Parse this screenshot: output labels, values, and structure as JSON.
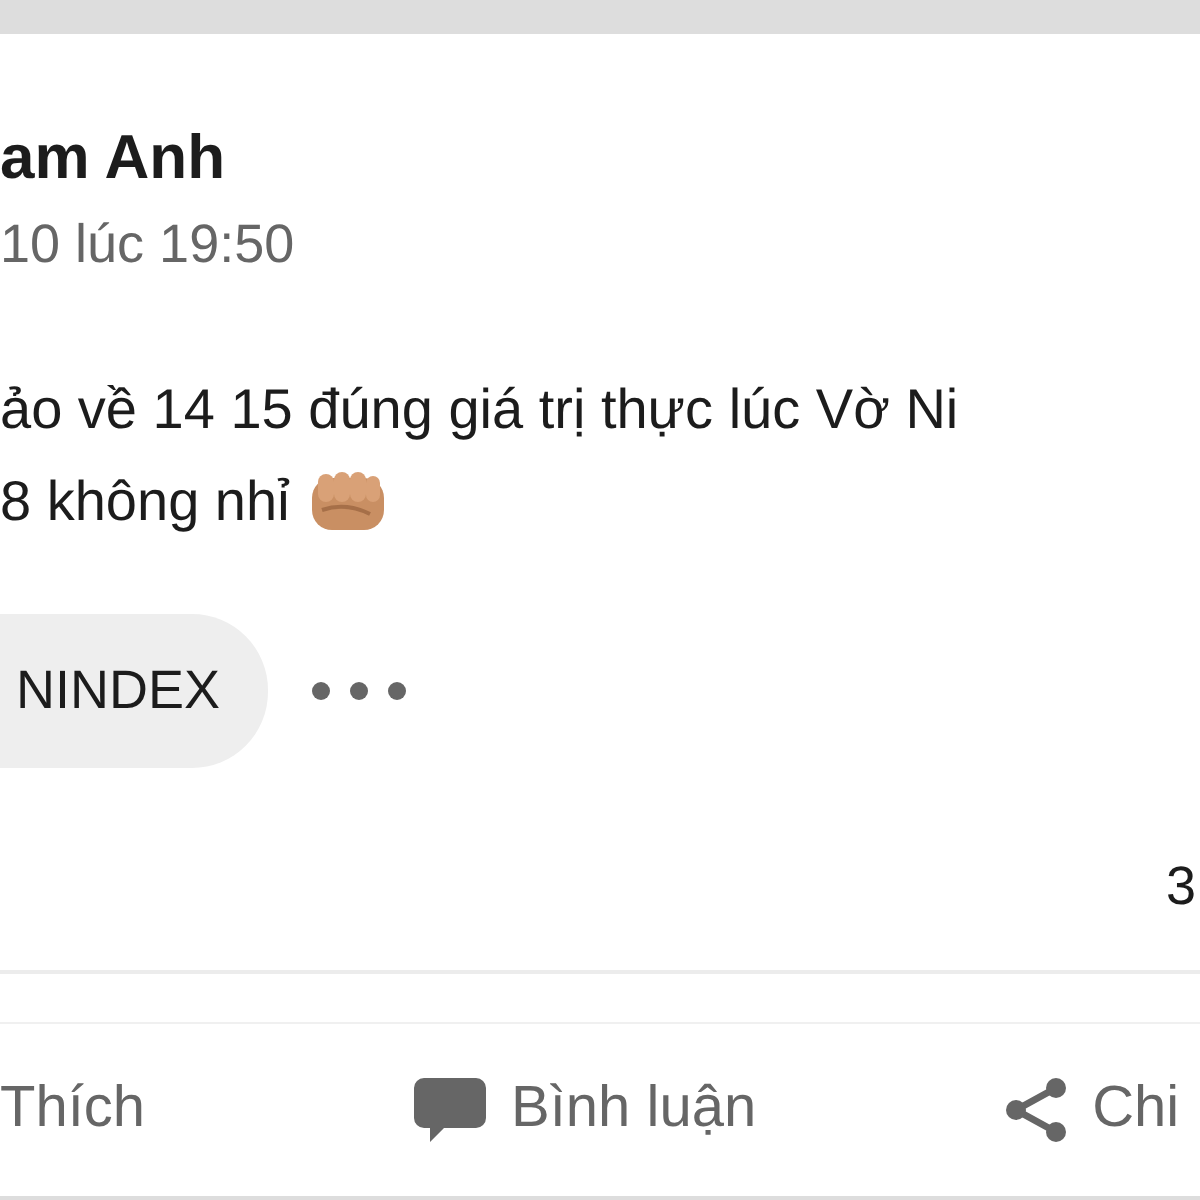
{
  "post": {
    "author": "am Anh",
    "timestamp": "10 lúc 19:50",
    "lines": [
      "ảo về 14 15 đúng giá trị thực lúc Vờ Ni",
      "8 không nhỉ"
    ],
    "tag": "NINDEX",
    "reaction_count": "3"
  },
  "actions": [
    {
      "kind": "like",
      "label": "Thích"
    },
    {
      "kind": "comment",
      "label": "Bình luận"
    },
    {
      "kind": "share",
      "label": "Chi"
    }
  ]
}
